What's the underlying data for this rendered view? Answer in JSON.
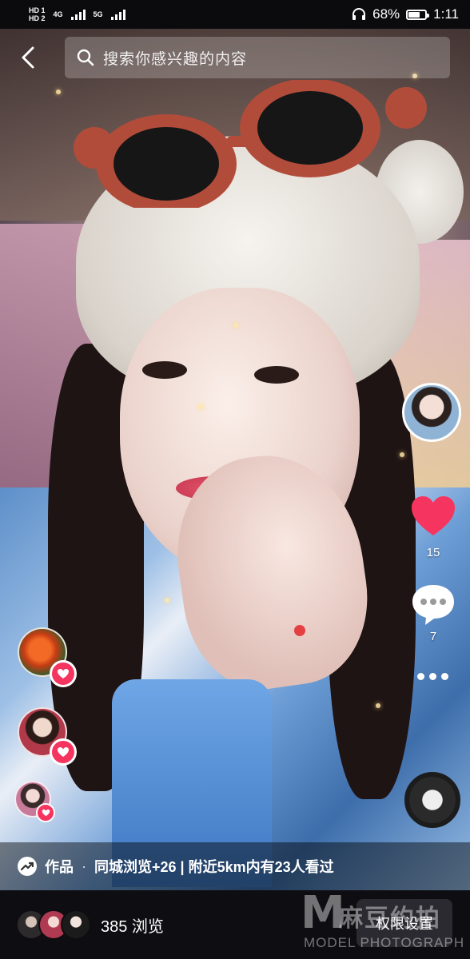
{
  "status_bar": {
    "sim1": "HD 1",
    "sim2": "HD 2",
    "net1": "4G",
    "net2": "5G",
    "battery_text": "68%",
    "battery_level": 0.68,
    "time": "1:11"
  },
  "search": {
    "placeholder": "搜索你感兴趣的内容"
  },
  "actions": {
    "like_count": "15",
    "comment_count": "7"
  },
  "works_bar": {
    "label": "作品",
    "separator": "·",
    "views_text": "同城浏览+26 | 附近5km内有23人看过"
  },
  "bottom": {
    "view_count": "385 浏览",
    "permission_button": "权限设置"
  },
  "watermark": {
    "logo": "M",
    "cn": "麻豆约拍",
    "en": "MODEL PHOTOGRAPH"
  },
  "colors": {
    "like": "#f5355f",
    "bottom_bar": "#0e0d11",
    "button_bg": "#2b2a31"
  }
}
